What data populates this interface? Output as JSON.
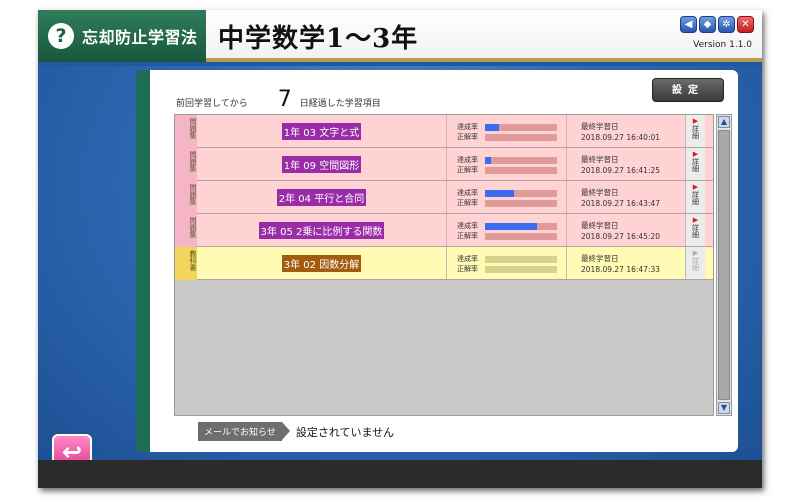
{
  "app": {
    "name": "忘却防止学習法",
    "course_title": "中学数学1～3年",
    "version": "Version 1.1.0"
  },
  "header": {
    "prefix": "前回学習してから",
    "days": "7",
    "suffix": "日経過した学習項目",
    "settings_button": "設定"
  },
  "row_labels": {
    "achievement": "達成率",
    "correct": "正解率",
    "last_study": "最終学習日",
    "detail": "詳細"
  },
  "items": [
    {
      "tag": "問題集",
      "title": "1年 03 文字と式",
      "achievement": 0.2,
      "correct": 0.0,
      "date": "2018.09.27 16:40:01",
      "type": "pink",
      "detail_enabled": true
    },
    {
      "tag": "問題集",
      "title": "1年 09 空間図形",
      "achievement": 0.08,
      "correct": 0.0,
      "date": "2018.09.27 16:41:25",
      "type": "pink",
      "detail_enabled": true
    },
    {
      "tag": "問題集",
      "title": "2年 04 平行と合同",
      "achievement": 0.4,
      "correct": 0.0,
      "date": "2018.09.27 16:43:47",
      "type": "pink",
      "detail_enabled": true
    },
    {
      "tag": "問題集",
      "title": "3年 05 2乗に比例する関数",
      "achievement": 0.72,
      "correct": 0.0,
      "date": "2018.09.27 16:45:20",
      "type": "pink",
      "detail_enabled": true
    },
    {
      "tag": "教科書",
      "title": "3年 02 因数分解",
      "achievement": 0.0,
      "correct": 0.0,
      "date": "2018.09.27 16:47:33",
      "type": "yellow",
      "detail_enabled": false
    }
  ],
  "mail": {
    "label": "メールでお知らせ",
    "status": "設定されていません"
  },
  "icons": [
    "help-icon",
    "mute-icon",
    "cube-icon",
    "gear-icon",
    "close-icon",
    "back-arrow-icon",
    "scroll-up-icon",
    "scroll-down-icon"
  ],
  "colors": {
    "accent_green": "#1d6c54",
    "background_blue": "#2f6ab5",
    "progress_blue": "#3a6cf0"
  }
}
